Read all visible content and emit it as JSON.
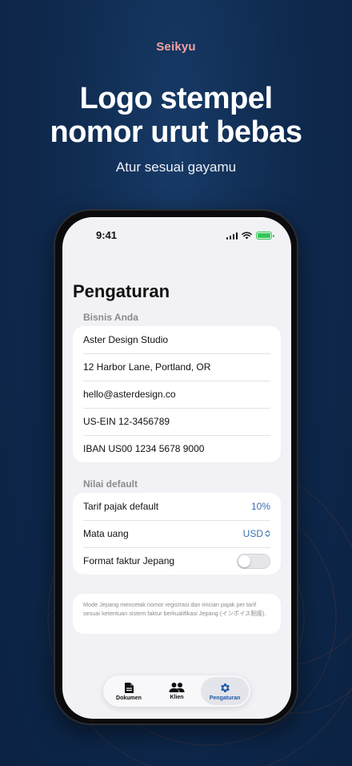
{
  "hero": {
    "brand": "Seikyu",
    "headline_line1": "Logo stempel",
    "headline_line2": "nomor urut bebas",
    "subheadline": "Atur sesuai gayamu"
  },
  "status_bar": {
    "time": "9:41",
    "icons": [
      "signal-icon",
      "wifi-icon",
      "battery-charging-icon"
    ]
  },
  "settings": {
    "title": "Pengaturan",
    "business_section": {
      "header": "Bisnis Anda",
      "rows": [
        "Aster Design Studio",
        "12 Harbor Lane, Portland, OR",
        "hello@asterdesign.co",
        "US-EIN 12-3456789",
        "IBAN US00 1234 5678 9000"
      ]
    },
    "defaults_section": {
      "header": "Nilai default",
      "tax_label": "Tarif pajak default",
      "tax_value": "10%",
      "currency_label": "Mata uang",
      "currency_value": "USD",
      "japan_format_label": "Format faktur Jepang",
      "japan_format_enabled": false
    },
    "note": "Mode Jepang mencetak nomor registrasi dan rincian pajak per tarif sesuai ketentuan sistem faktur berkualifikasi Jepang (インボイス制度)."
  },
  "tab_bar": {
    "tabs": [
      {
        "label": "Dokumen",
        "icon": "document-icon",
        "active": false
      },
      {
        "label": "Klien",
        "icon": "people-icon",
        "active": false
      },
      {
        "label": "Pengaturan",
        "icon": "gear-icon",
        "active": true
      }
    ]
  },
  "colors": {
    "background": "#0f2a4f",
    "brand_accent": "#f2a3a3",
    "link_blue": "#3a6fb0",
    "battery_green": "#34c759"
  }
}
